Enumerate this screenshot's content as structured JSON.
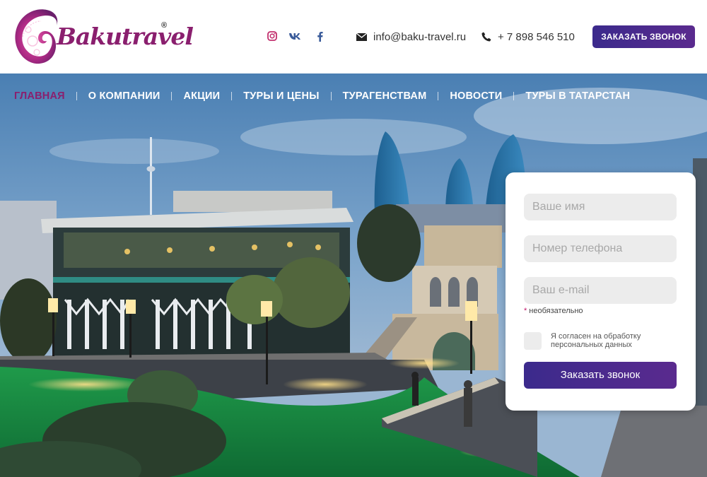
{
  "brand": {
    "name": "Bakutravel",
    "registered": "®",
    "color": "#8a1f6e"
  },
  "header": {
    "social": [
      {
        "icon": "instagram-icon",
        "color": "#b03a8c"
      },
      {
        "icon": "vk-icon",
        "color": "#3a5b9a"
      },
      {
        "icon": "facebook-icon",
        "color": "#3a5b9a"
      }
    ],
    "email": "info@baku-travel.ru",
    "phone": "+ 7 898 546 510",
    "cta_label": "ЗАКАЗАТЬ ЗВОНОК"
  },
  "nav": {
    "items": [
      {
        "label": "ГЛАВНАЯ",
        "active": true
      },
      {
        "label": "О КОМПАНИИ"
      },
      {
        "label": "АКЦИИ"
      },
      {
        "label": "ТУРЫ И ЦЕНЫ"
      },
      {
        "label": "ТУРАГЕНСТВАМ"
      },
      {
        "label": "НОВОСТИ"
      },
      {
        "label": "ТУРЫ В ТАТАРСТАН"
      }
    ]
  },
  "form": {
    "name_placeholder": "Ваше имя",
    "phone_placeholder": "Номер телефона",
    "email_placeholder": "Ваш e-mail",
    "optional_star": "*",
    "optional_note": "необязательно",
    "agree_label": "Я согласен на обработку персональных данных",
    "submit_label": "Заказать звонок"
  },
  "colors": {
    "accent": "#3b2a8c",
    "accent2": "#5a2a8e",
    "nav_active": "#8a1f6e"
  }
}
